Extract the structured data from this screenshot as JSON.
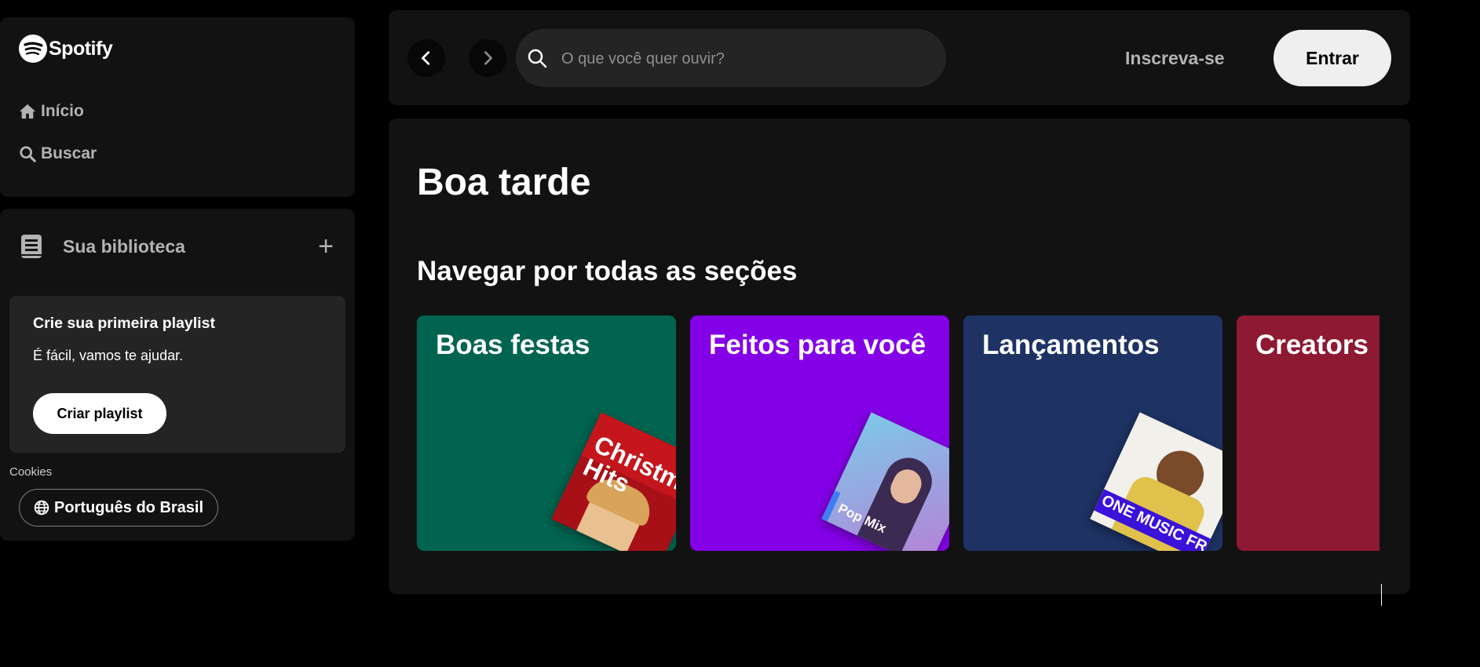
{
  "app": {
    "name": "Spotify"
  },
  "nav": {
    "home_label": "Início",
    "search_label": "Buscar"
  },
  "library": {
    "title": "Sua biblioteca",
    "add_label": "+",
    "create_card": {
      "title": "Crie sua primeira playlist",
      "subtitle": "É fácil, vamos te ajudar.",
      "button_label": "Criar playlist"
    },
    "cookies_label": "Cookies",
    "language_label": "Português do Brasil"
  },
  "topbar": {
    "search_placeholder": "O que você quer ouvir?",
    "signup_label": "Inscreva-se",
    "login_label": "Entrar"
  },
  "main": {
    "greeting": "Boa tarde",
    "section_title": "Navegar por todas as seções",
    "cards": [
      {
        "title": "Boas festas",
        "color": "#006450",
        "cover_text": "Christmas Hits"
      },
      {
        "title": "Feitos para você",
        "color": "#8400e7",
        "cover_text": "Pop Mix"
      },
      {
        "title": "Lançamentos",
        "color": "#1e3264",
        "cover_text": "ONE MUSIC FRIDAY"
      },
      {
        "title": "Creators",
        "color": "#8d1932"
      }
    ]
  },
  "colors": {
    "background": "#000000",
    "panel": "#121212",
    "card_bg": "#242424",
    "muted_text": "#b3b3b3"
  }
}
